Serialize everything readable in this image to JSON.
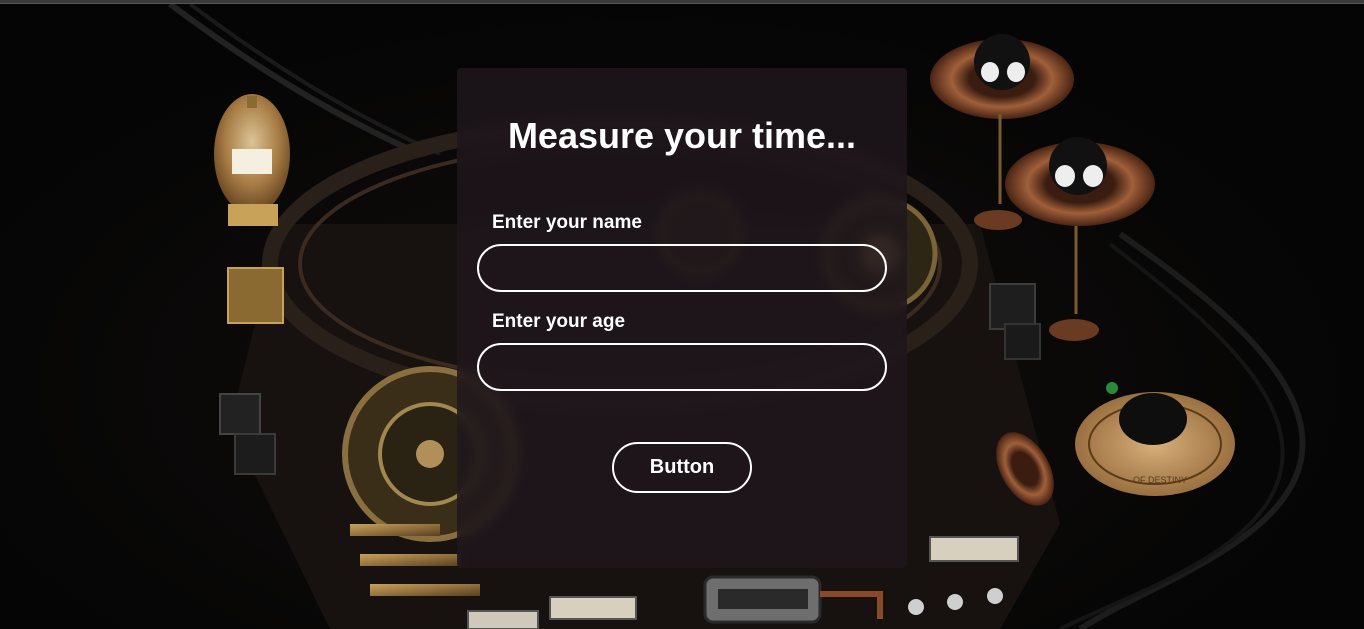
{
  "form": {
    "title": "Measure your time...",
    "name_label": "Enter your name",
    "name_value": "",
    "age_label": "Enter your age",
    "age_value": "",
    "submit_label": "Button"
  },
  "scene": {
    "plaque_text": "OF DESTINY"
  },
  "colors": {
    "card_background": "#1e161c",
    "text": "#ffffff",
    "input_border": "#ffffff",
    "brass": "#b08a4a",
    "copper": "#8a4a2a"
  }
}
